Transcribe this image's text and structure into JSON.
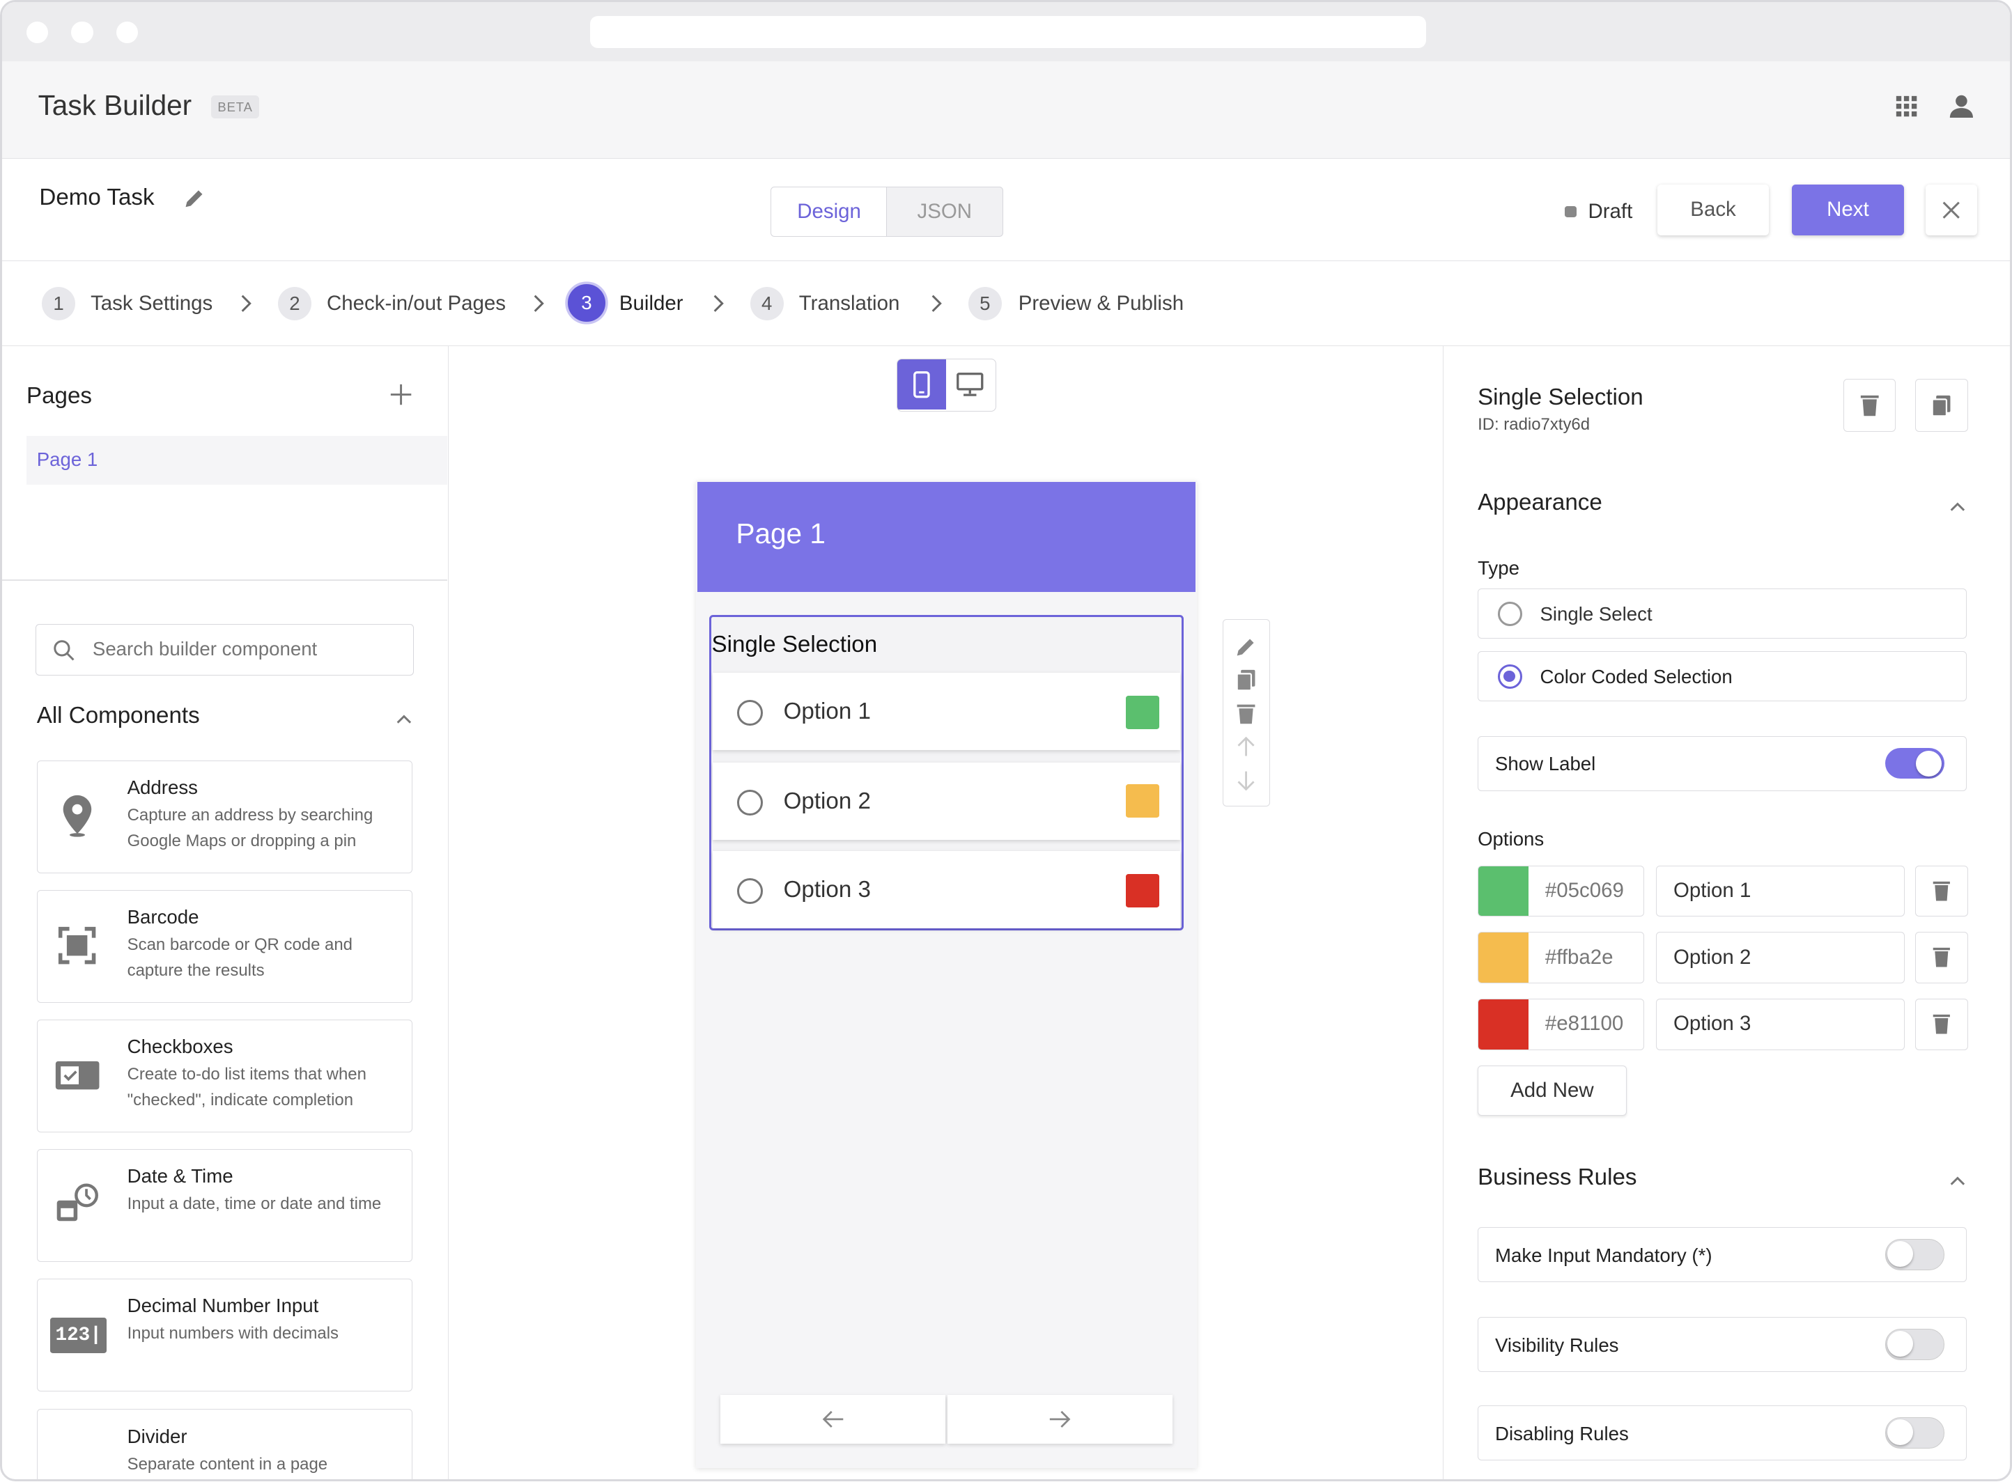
{
  "app": {
    "title": "Task Builder",
    "badge": "BETA"
  },
  "task": {
    "name": "Demo Task",
    "status": "Draft"
  },
  "view_tabs": [
    {
      "label": "Design"
    },
    {
      "label": "JSON"
    }
  ],
  "actions": {
    "back": "Back",
    "next": "Next"
  },
  "steps": [
    {
      "num": "1",
      "label": "Task Settings"
    },
    {
      "num": "2",
      "label": "Check-in/out Pages"
    },
    {
      "num": "3",
      "label": "Builder"
    },
    {
      "num": "4",
      "label": "Translation"
    },
    {
      "num": "5",
      "label": "Preview & Publish"
    }
  ],
  "pages": {
    "heading": "Pages",
    "items": [
      {
        "label": "Page 1"
      }
    ]
  },
  "search": {
    "placeholder": "Search builder component"
  },
  "components": {
    "heading": "All Components",
    "items": [
      {
        "name": "Address",
        "desc": "Capture an address by searching Google Maps or dropping a pin",
        "icon": "location-pin-icon"
      },
      {
        "name": "Barcode",
        "desc": "Scan barcode or QR code and capture the results",
        "icon": "barcode-scan-icon"
      },
      {
        "name": "Checkboxes",
        "desc": "Create to-do list items that when \"checked\", indicate completion",
        "icon": "checkbox-icon"
      },
      {
        "name": "Date & Time",
        "desc": "Input a date, time or date and time",
        "icon": "calendar-clock-icon"
      },
      {
        "name": "Decimal Number Input",
        "desc": "Input numbers with decimals",
        "icon": "number-input-icon",
        "icon_text": "123|"
      },
      {
        "name": "Divider",
        "desc": "Separate content in a page",
        "icon": "divider-icon"
      }
    ]
  },
  "canvas": {
    "page_title": "Page 1",
    "field_label": "Single Selection",
    "options": [
      {
        "label": "Option 1",
        "color": "#05c069"
      },
      {
        "label": "Option 2",
        "color": "#ffba2e"
      },
      {
        "label": "Option 3",
        "color": "#e81100"
      }
    ]
  },
  "properties": {
    "title": "Single Selection",
    "id": "ID: radio7xty6d",
    "appearance": {
      "heading": "Appearance",
      "type_label": "Type",
      "types": [
        {
          "label": "Single Select",
          "selected": false
        },
        {
          "label": "Color Coded Selection",
          "selected": true
        }
      ],
      "show_label": "Show Label",
      "show_label_on": true
    },
    "options_heading": "Options",
    "options": [
      {
        "hex": "#05c069",
        "label": "Option 1",
        "color": "#05c069"
      },
      {
        "hex": "#ffba2e",
        "label": "Option 2",
        "color": "#ffba2e"
      },
      {
        "hex": "#e81100",
        "label": "Option 3",
        "color": "#e81100"
      }
    ],
    "add_new": "Add New",
    "business_rules": {
      "heading": "Business Rules",
      "rules": [
        {
          "label": "Make Input Mandatory (*)",
          "on": false
        },
        {
          "label": "Visibility Rules",
          "on": false
        },
        {
          "label": "Disabling Rules",
          "on": false
        }
      ]
    }
  },
  "colors": {
    "accent": "#7b73e6",
    "opt1": "#5bbf6e",
    "opt2": "#f5bc4e",
    "opt3": "#d93025"
  }
}
